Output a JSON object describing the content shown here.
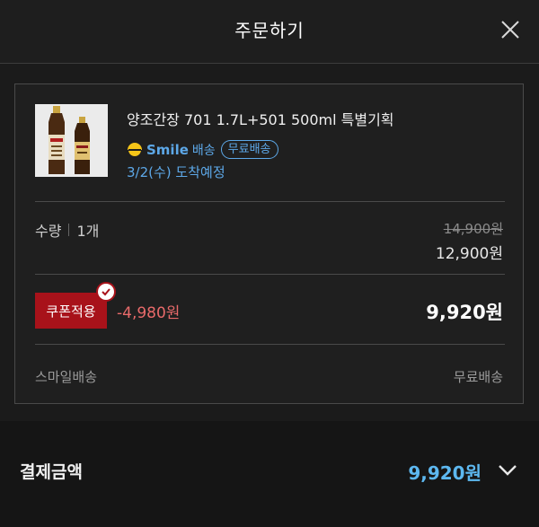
{
  "header": {
    "title": "주문하기",
    "close_icon": "close-icon"
  },
  "product": {
    "name": "양조간장 701 1.7L+501 500ml 특별기획",
    "image_icon": "soy-sauce-bottles-image",
    "smile_label": "Smile",
    "shipping_label": "배송",
    "free_shipping_badge": "무료배송",
    "arrival": "3/2(수) 도착예정"
  },
  "quantity": {
    "label": "수량",
    "value": "1개"
  },
  "price": {
    "original": "14,900원",
    "sale": "12,900원"
  },
  "coupon": {
    "button_label": "쿠폰적용",
    "discount": "-4,980원",
    "final_price": "9,920원"
  },
  "delivery": {
    "method": "스마일배송",
    "cost": "무료배송"
  },
  "footer": {
    "pay_label": "결제금액",
    "pay_amount": "9,920원",
    "expand_icon": "chevron-down-icon"
  },
  "colors": {
    "accent_blue": "#5da8e8",
    "coupon_red": "#a8121a",
    "discount_red": "#e86a6a",
    "smile_yellow": "#f5c518"
  }
}
